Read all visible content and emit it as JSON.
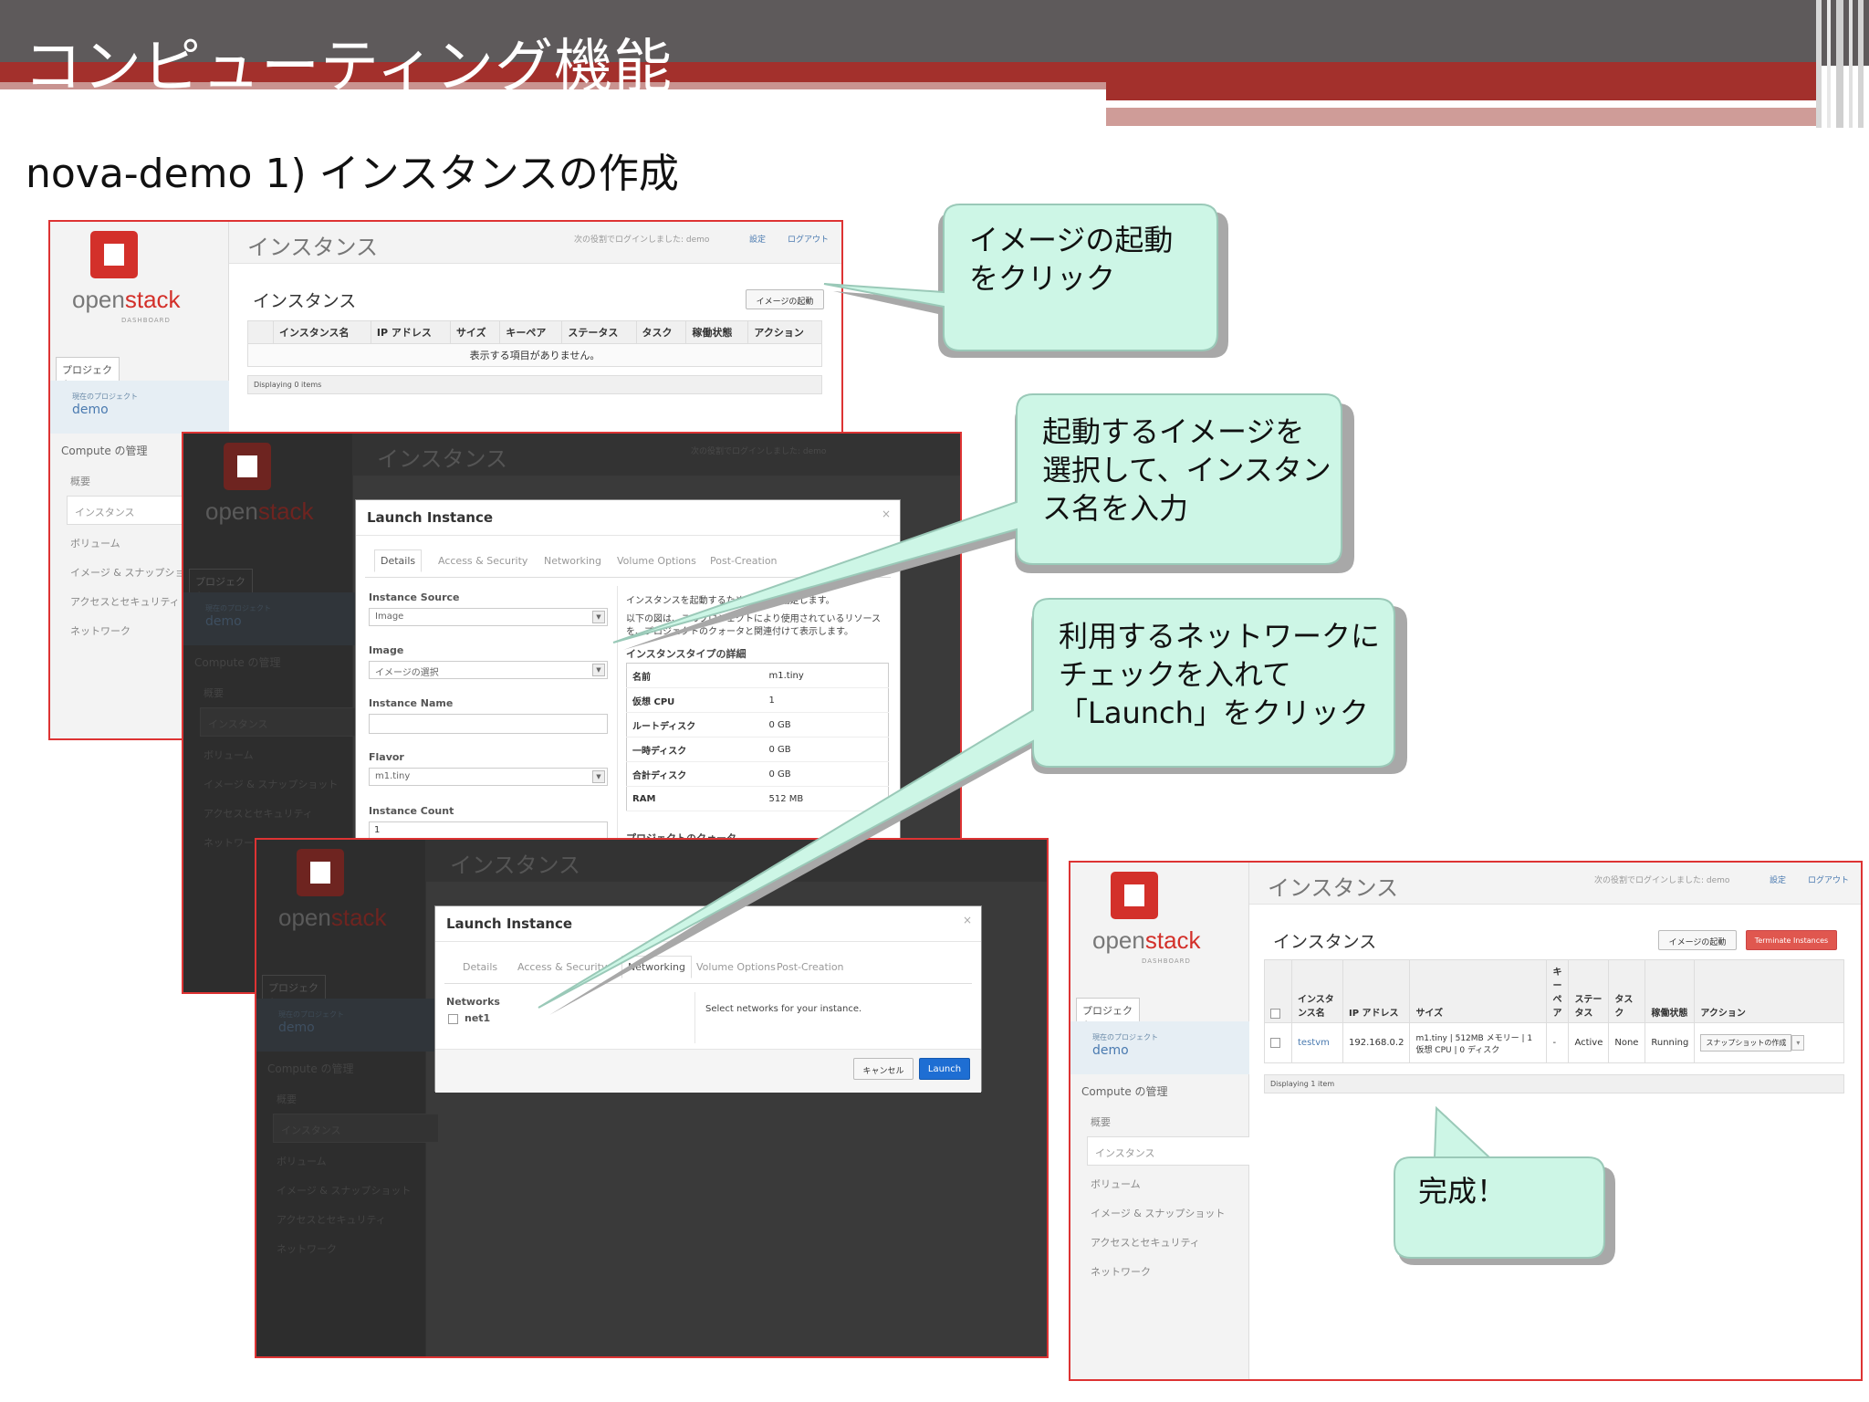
{
  "slide": {
    "title": "コンピューティング機能",
    "subtitle": "nova-demo 1) インスタンスの作成"
  },
  "sidebar": {
    "brand_open": "open",
    "brand_stack": "stack",
    "brand_sub": "DASHBOARD",
    "tab": "プロジェクト",
    "current_project_label": "現在のプロジェクト",
    "current_project": "demo",
    "compute_heading": "Compute の管理",
    "items": [
      "概要",
      "インスタンス",
      "ボリューム",
      "イメージ & スナップショット",
      "アクセスとセキュリティ",
      "ネットワーク"
    ]
  },
  "topbar": {
    "title": "インスタンス",
    "logged_in": "次の役割でログインしました: demo",
    "settings": "設定",
    "logout": "ログアウト"
  },
  "screen1": {
    "section_title": "インスタンス",
    "launch_button": "イメージの起動",
    "columns": [
      "インスタンス名",
      "IP アドレス",
      "サイズ",
      "キーペア",
      "ステータス",
      "タスク",
      "稼働状態",
      "アクション"
    ],
    "empty_message": "表示する項目がありません。",
    "footer": "Displaying 0 items"
  },
  "screen2": {
    "modal_title": "Launch Instance",
    "close": "×",
    "tabs": [
      "Details",
      "Access & Security",
      "Networking",
      "Volume Options",
      "Post-Creation"
    ],
    "instance_source_label": "Instance Source",
    "instance_source_value": "Image",
    "image_label": "Image",
    "image_value": "イメージの選択",
    "instance_name_label": "Instance Name",
    "instance_name_value": "",
    "flavor_label": "Flavor",
    "flavor_value": "m1.tiny",
    "instance_count_label": "Instance Count",
    "instance_count_value": "1",
    "desc1": "インスタンスを起動するための詳細を指定します。",
    "desc2": "以下の図は、このプロジェクトにより使用されているリソースを、プロジェクトのクォータと関連付けて表示します。",
    "flavor_details_title": "インスタンスタイプの詳細",
    "flavor_details": [
      {
        "k": "名前",
        "v": "m1.tiny"
      },
      {
        "k": "仮想 CPU",
        "v": "1"
      },
      {
        "k": "ルートディスク",
        "v": "0 GB"
      },
      {
        "k": "一時ディスク",
        "v": "0 GB"
      },
      {
        "k": "合計ディスク",
        "v": "0 GB"
      },
      {
        "k": "RAM",
        "v": "512 MB"
      }
    ],
    "quota_title": "プロジェクトのクォータ"
  },
  "screen3": {
    "modal_title": "Launch Instance",
    "close": "×",
    "tabs": [
      "Details",
      "Access & Security",
      "Networking",
      "Volume Options",
      "Post-Creation"
    ],
    "networks_label": "Networks",
    "network_item": "net1",
    "networks_help": "Select networks for your instance.",
    "cancel": "キャンセル",
    "launch": "Launch"
  },
  "screen4": {
    "section_title": "インスタンス",
    "launch_button": "イメージの起動",
    "terminate_button": "Terminate Instances",
    "columns": [
      "インスタンス名",
      "IP アドレス",
      "サイズ",
      "キーペア",
      "ステータス",
      "タスク",
      "稼働状態",
      "アクション"
    ],
    "row": {
      "name": "testvm",
      "ip": "192.168.0.2",
      "size": "m1.tiny | 512MB メモリー | 1 仮想 CPU | 0 ディスク",
      "keypair": "-",
      "status": "Active",
      "task": "None",
      "power": "Running",
      "action": "スナップショットの作成"
    },
    "footer": "Displaying 1 item"
  },
  "callouts": {
    "c1": "イメージの起動\nをクリック",
    "c2": "起動するイメージを\n選択して、インスタン\nス名を入力",
    "c3": "利用するネットワークに\nチェックを入れて\n「Launch」をクリック",
    "c4": "完成！"
  },
  "colors": {
    "header_grey": "#5e5a5b",
    "header_red": "#a3302c",
    "frame_red": "#dd3333",
    "callout_fill": "#cdf6e6",
    "openstack_red": "#d3302a",
    "link_blue": "#4a7ab0"
  }
}
